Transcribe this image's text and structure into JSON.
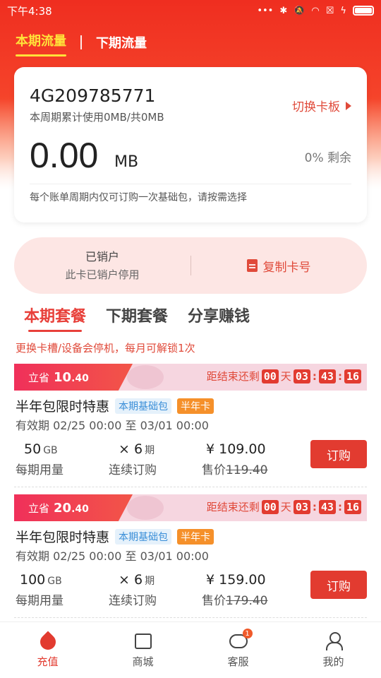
{
  "statusbar": {
    "time": "下午4:38",
    "icons": [
      "more-dots-icon",
      "bluetooth-icon",
      "mute-icon",
      "wifi-icon",
      "sim-error-icon",
      "charging-icon",
      "battery-icon"
    ]
  },
  "top_tabs": [
    {
      "label": "本期流量",
      "active": true
    },
    {
      "label": "下期流量",
      "active": false
    }
  ],
  "card": {
    "number": "4G209785771",
    "usage": "本周期累计使用0MB/共0MB",
    "switch_label": "切换卡板",
    "remaining_value": "0.00",
    "unit": "MB",
    "percent_label": "0% 剩余",
    "note": "每个账单周期内仅可订购一次基础包，请按需选择"
  },
  "account": {
    "status": "已销户",
    "description": "此卡已销户停用",
    "copy_label": "复制卡号"
  },
  "package_tabs": [
    {
      "label": "本期套餐",
      "active": true
    },
    {
      "label": "下期套餐",
      "active": false
    },
    {
      "label": "分享赚钱",
      "active": false
    }
  ],
  "notice": "更换卡槽/设备会停机，每月可解锁1次",
  "offers": [
    {
      "save_prefix": "立省",
      "save_int": "10",
      "save_dec": ".40",
      "countdown_label": "距结束还剩",
      "days": "00",
      "day_unit": "天",
      "hours": "03",
      "minutes": "43",
      "seconds": "16",
      "title": "半年包限时特惠",
      "tag1": "本期基础包",
      "tag2": "半年卡",
      "validity": "有效期 02/25 00:00 至 03/01 00:00",
      "data_value": "50",
      "data_unit": "GB",
      "data_label": "每期用量",
      "periods_prefix": "× 6",
      "periods_unit": "期",
      "periods_label": "连续订购",
      "price": "¥ 109.00",
      "price_label_prefix": "售价",
      "original_price": "119.40",
      "buy_label": "订购"
    },
    {
      "save_prefix": "立省",
      "save_int": "20",
      "save_dec": ".40",
      "countdown_label": "距结束还剩",
      "days": "00",
      "day_unit": "天",
      "hours": "03",
      "minutes": "43",
      "seconds": "16",
      "title": "半年包限时特惠",
      "tag1": "本期基础包",
      "tag2": "半年卡",
      "validity": "有效期 02/25 00:00 至 03/01 00:00",
      "data_value": "100",
      "data_unit": "GB",
      "data_label": "每期用量",
      "periods_prefix": "× 6",
      "periods_unit": "期",
      "periods_label": "连续订购",
      "price": "¥ 159.00",
      "price_label_prefix": "售价",
      "original_price": "179.40",
      "buy_label": "订购"
    }
  ],
  "tabbar": [
    {
      "label": "充值",
      "icon": "recharge-drop-icon",
      "active": true
    },
    {
      "label": "商城",
      "icon": "mall-box-icon",
      "active": false
    },
    {
      "label": "客服",
      "icon": "service-chat-icon",
      "active": false,
      "badge": "1"
    },
    {
      "label": "我的",
      "icon": "profile-icon",
      "active": false
    }
  ],
  "colors": {
    "accent": "#e23b30",
    "header": "#f5432a",
    "tab_active": "#ffe23a",
    "tag_blue": "#3a8ed8",
    "tag_orange": "#f5902a"
  }
}
